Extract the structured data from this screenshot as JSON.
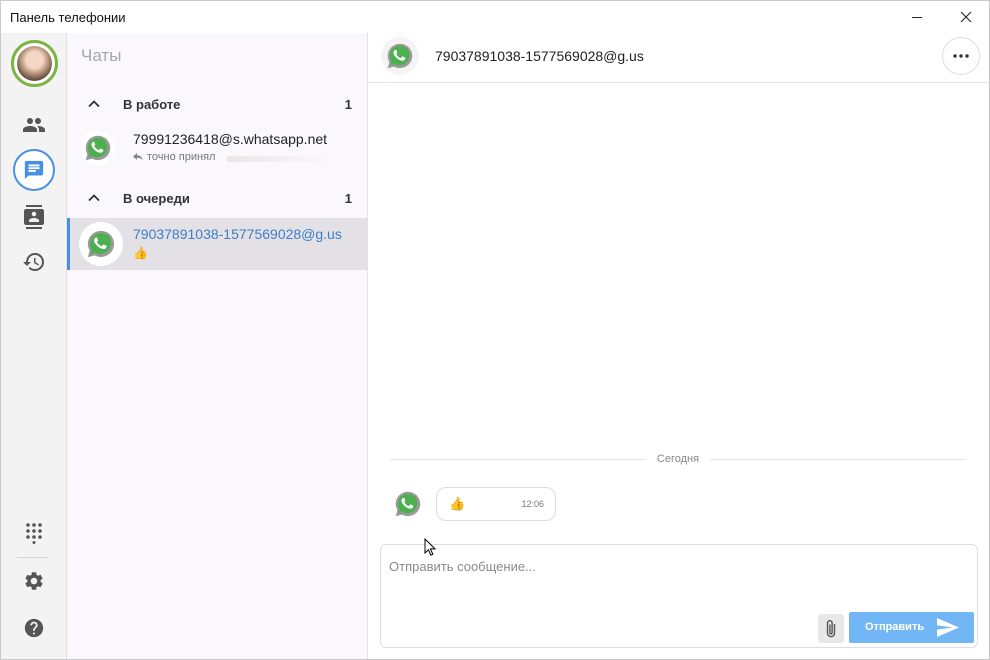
{
  "window": {
    "title": "Панель телефонии",
    "minimize_icon": "minimize-icon",
    "close_icon": "close-icon"
  },
  "rail": {
    "items": [
      {
        "name": "contacts",
        "icon": "people-icon"
      },
      {
        "name": "chats",
        "icon": "chat-icon",
        "active": true
      },
      {
        "name": "address-book",
        "icon": "contact-card-icon"
      },
      {
        "name": "history",
        "icon": "history-icon"
      },
      {
        "name": "dialpad",
        "icon": "dialpad-icon"
      },
      {
        "name": "settings",
        "icon": "gear-icon"
      },
      {
        "name": "help",
        "icon": "help-icon"
      }
    ],
    "accent_color": "#4a90e2",
    "avatar_ring_color": "#7cb342"
  },
  "chat_list": {
    "heading": "Чаты",
    "groups": [
      {
        "name": "В работе",
        "count": "1",
        "chats": [
          {
            "name": "79991236418@s.whatsapp.net",
            "preview": "точно принял",
            "preview_icon": "reply-icon"
          }
        ]
      },
      {
        "name": "В очереди",
        "count": "1",
        "chats": [
          {
            "name": "79037891038-1577569028@g.us",
            "preview": "👍",
            "selected": true
          }
        ]
      }
    ]
  },
  "conversation": {
    "title": "79037891038-1577569028@g.us",
    "more_icon": "more-icon",
    "day_separator": "Сегодня",
    "messages": [
      {
        "content": "👍",
        "time": "12:06"
      }
    ]
  },
  "composer": {
    "placeholder": "Отправить сообщение...",
    "send_label": "Отправить",
    "attach_icon": "paperclip-icon",
    "send_icon": "send-icon",
    "send_color": "#73b6f5"
  }
}
